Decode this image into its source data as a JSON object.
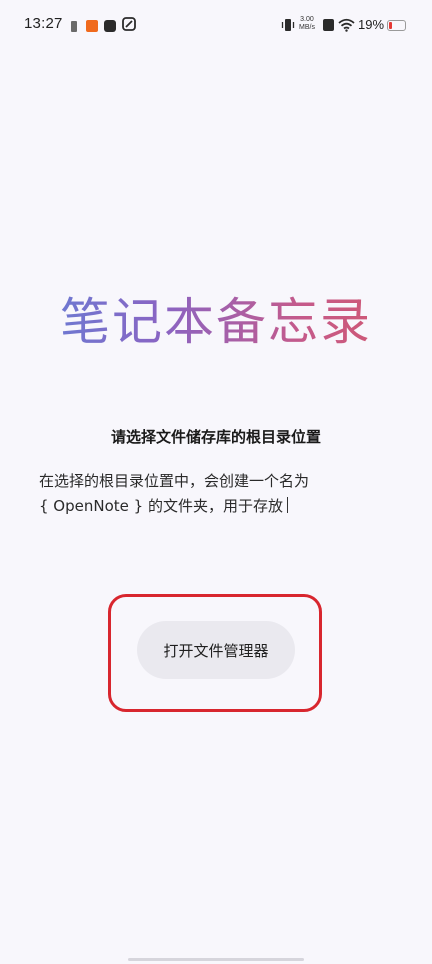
{
  "status_bar": {
    "time": "13:27",
    "net_speed_value": "3.00",
    "net_speed_unit": "MB/s",
    "battery_percent": "19%",
    "battery_level": 0.19,
    "icons": [
      "sim-card-icon",
      "taobao-icon",
      "mail-icon",
      "link-icon",
      "vibrate-icon",
      "no-sim-icon",
      "wifi-icon",
      "battery-icon"
    ],
    "battery_color": "#e53935"
  },
  "app": {
    "title": "笔记本备忘录",
    "title_gradient": [
      "#5f83d8",
      "#8a64c3",
      "#c55a8a",
      "#d55868"
    ]
  },
  "content": {
    "subtitle": "请选择文件储存库的根目录位置",
    "desc_line1": "在选择的根目录位置中，会创建一个名为",
    "desc_line2": "{ OpenNote } 的文件夹，用于存放"
  },
  "button": {
    "open_file_manager_label": "打开文件管理器",
    "highlight_color": "#d8262e"
  }
}
